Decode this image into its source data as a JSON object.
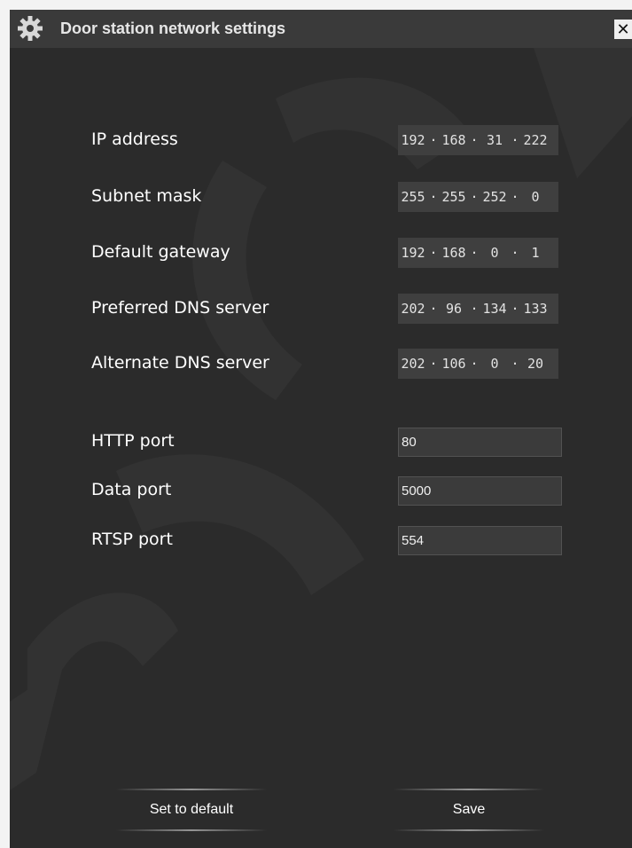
{
  "window": {
    "title": "Door station network settings",
    "close_symbol": "✕"
  },
  "network": {
    "ip_address": {
      "label": "IP address",
      "octets": [
        "192",
        "168",
        "31",
        "222"
      ]
    },
    "subnet_mask": {
      "label": "Subnet mask",
      "octets": [
        "255",
        "255",
        "252",
        "0"
      ]
    },
    "default_gateway": {
      "label": "Default gateway",
      "octets": [
        "192",
        "168",
        "0",
        "1"
      ]
    },
    "preferred_dns": {
      "label": "Preferred DNS server",
      "octets": [
        "202",
        "96",
        "134",
        "133"
      ]
    },
    "alternate_dns": {
      "label": "Alternate DNS server",
      "octets": [
        "202",
        "106",
        "0",
        "20"
      ]
    }
  },
  "ports": {
    "http": {
      "label": "HTTP port",
      "value": "80"
    },
    "data": {
      "label": "Data port",
      "value": "5000"
    },
    "rtsp": {
      "label": "RTSP port",
      "value": "554"
    }
  },
  "buttons": {
    "set_default": "Set to default",
    "save": "Save"
  },
  "icons": {
    "title": "gear-icon",
    "close": "close-icon"
  },
  "colors": {
    "background": "#2b2b2b",
    "titlebar": "#3a3a3a",
    "field": "#3f3f3f",
    "text": "#ffffff"
  }
}
